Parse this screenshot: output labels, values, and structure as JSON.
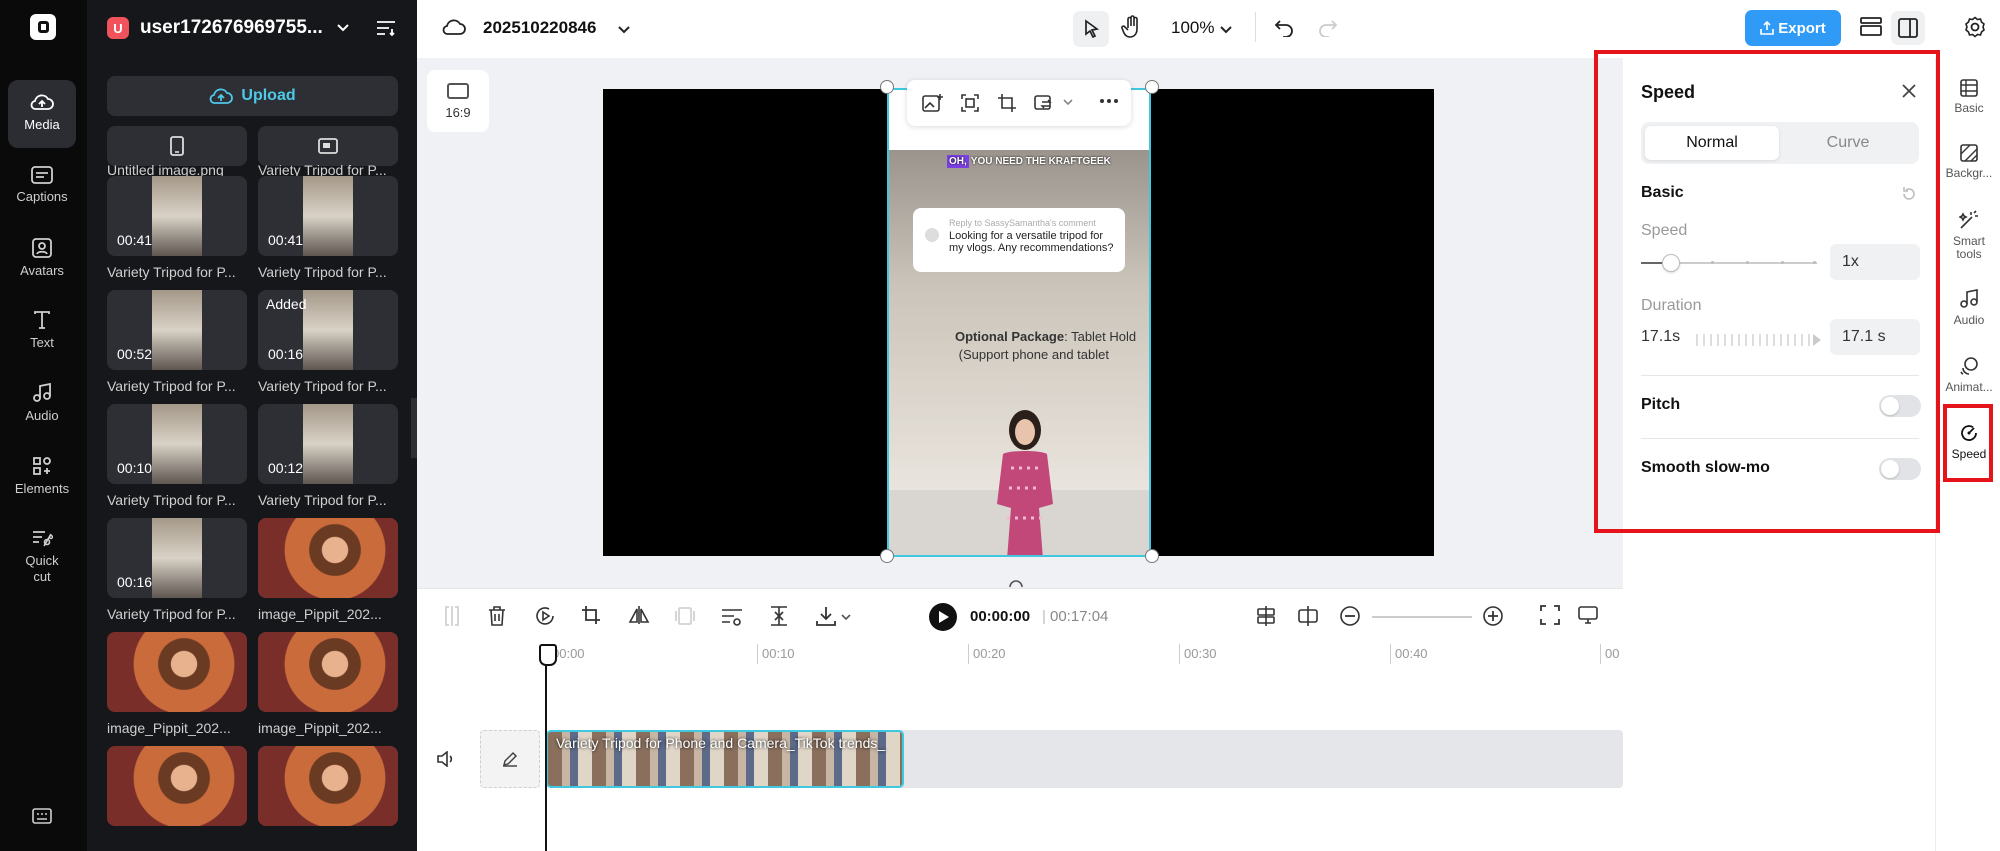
{
  "left_rail": {
    "items": [
      {
        "label": "Media",
        "icon": "cloud-upload-icon",
        "active": true
      },
      {
        "label": "Captions",
        "icon": "captions-icon"
      },
      {
        "label": "Avatars",
        "icon": "avatar-icon"
      },
      {
        "label": "Text",
        "icon": "text-icon"
      },
      {
        "label": "Audio",
        "icon": "music-note-icon"
      },
      {
        "label": "Elements",
        "icon": "elements-icon"
      },
      {
        "label": "Quick cut",
        "icon": "quick-cut-icon"
      }
    ],
    "bottom_icon": "keyboard-icon"
  },
  "media_panel": {
    "user_initial": "U",
    "user_name": "user172676969755...",
    "upload_label": "Upload",
    "items": [
      {
        "caption": "Untitled image.png",
        "duration": "",
        "added": "",
        "kind": "partial"
      },
      {
        "caption": "Variety Tripod for P...",
        "duration": "",
        "added": "",
        "kind": "partial"
      },
      {
        "caption": "Variety Tripod for P...",
        "duration": "00:41",
        "added": "",
        "kind": "video"
      },
      {
        "caption": "Variety Tripod for P...",
        "duration": "00:41",
        "added": "",
        "kind": "video"
      },
      {
        "caption": "Variety Tripod for P...",
        "duration": "00:52",
        "added": "",
        "kind": "video"
      },
      {
        "caption": "Variety Tripod for P...",
        "duration": "00:16",
        "added": "Added",
        "kind": "video"
      },
      {
        "caption": "Variety Tripod for P...",
        "duration": "00:10",
        "added": "",
        "kind": "video"
      },
      {
        "caption": "Variety Tripod for P...",
        "duration": "00:12",
        "added": "",
        "kind": "video"
      },
      {
        "caption": "Variety Tripod for P...",
        "duration": "00:16",
        "added": "",
        "kind": "video"
      },
      {
        "caption": "image_Pippit_202...",
        "duration": "",
        "added": "",
        "kind": "image"
      },
      {
        "caption": "image_Pippit_202...",
        "duration": "",
        "added": "",
        "kind": "image"
      },
      {
        "caption": "image_Pippit_202...",
        "duration": "",
        "added": "",
        "kind": "image"
      },
      {
        "caption": "",
        "duration": "",
        "added": "",
        "kind": "image"
      },
      {
        "caption": "",
        "duration": "",
        "added": "",
        "kind": "image"
      }
    ]
  },
  "topbar": {
    "project_name": "202510220846",
    "zoom": "100%",
    "export_label": "Export"
  },
  "canvas": {
    "ratio_label": "16:9",
    "video": {
      "tag_badge": "OH,",
      "tag_text": "YOU NEED THE KRAFTGEEK",
      "reply_to": "Reply to SassySamantha's comment",
      "comment_line1": "Looking for a versatile tripod for",
      "comment_line2": "my vlogs. Any recommendations?",
      "pkg_bold": "Optional Package",
      "pkg_rest": ": Tablet Hold",
      "pkg_line2": "(Support phone and tablet"
    }
  },
  "playback": {
    "current": "00:00:00",
    "separator": "|",
    "total": "00:17:04"
  },
  "timeline": {
    "ruler": [
      "00:00",
      "00:10",
      "00:20",
      "00:30",
      "00:40",
      "00"
    ],
    "clip_label": "Variety Tripod for Phone and Camera_TikTok trends_"
  },
  "speed_panel": {
    "title": "Speed",
    "tabs": [
      "Normal",
      "Curve"
    ],
    "active_tab": "Normal",
    "basic_label": "Basic",
    "speed_label": "Speed",
    "speed_value": "1x",
    "speed_fraction": 0.17,
    "duration_label": "Duration",
    "duration_left": "17.1s",
    "duration_value": "17.1 s",
    "pitch_label": "Pitch",
    "pitch_on": false,
    "smooth_label": "Smooth slow-mo",
    "smooth_on": false
  },
  "right_rail": {
    "items": [
      {
        "label": "Basic",
        "icon": "basic-icon"
      },
      {
        "label": "Backgr...",
        "icon": "background-icon"
      },
      {
        "label": "Smart tools",
        "icon": "magic-wand-icon"
      },
      {
        "label": "Audio",
        "icon": "music-note-icon"
      },
      {
        "label": "Animat...",
        "icon": "animation-icon"
      },
      {
        "label": "Speed",
        "icon": "speedometer-icon",
        "active": true
      }
    ]
  },
  "colors": {
    "accent": "#2f9bf7",
    "selection": "#3fc8e0",
    "highlight_frame": "#e5141b",
    "rail_bg": "#0a0a0a",
    "panel_bg": "#16171a"
  }
}
